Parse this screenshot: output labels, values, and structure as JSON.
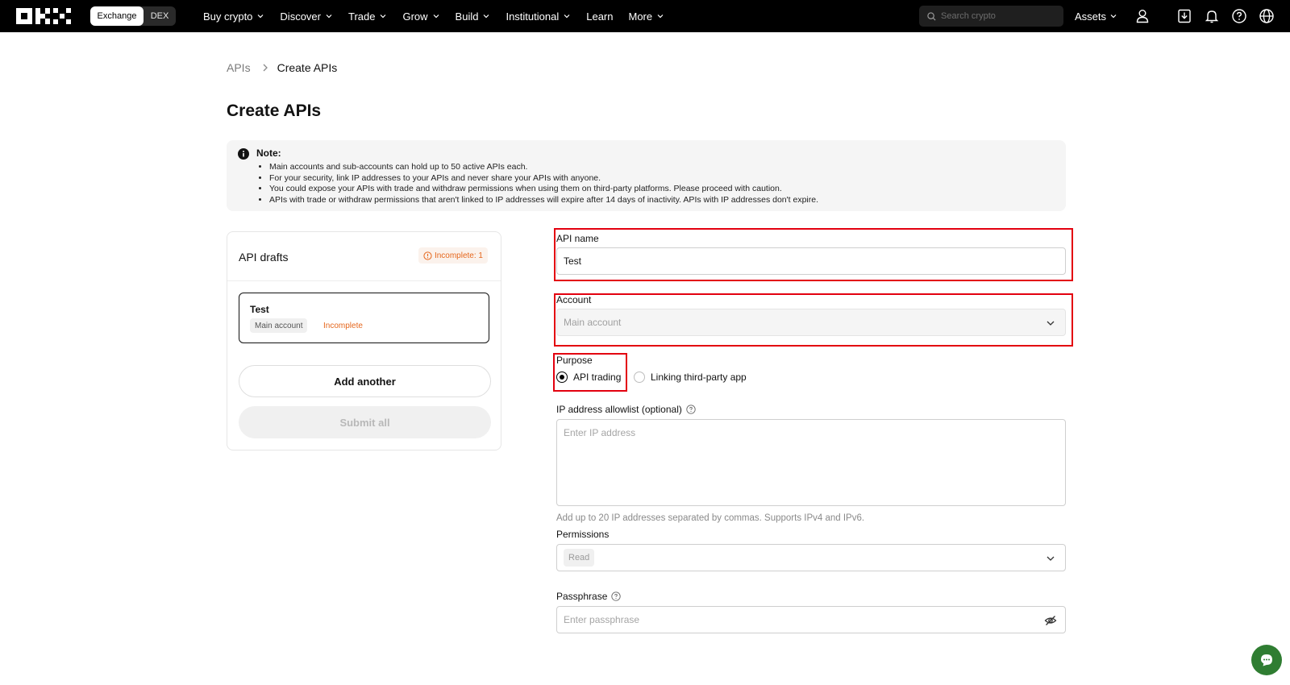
{
  "nav": {
    "toggle": {
      "exchange": "Exchange",
      "dex": "DEX"
    },
    "menu": [
      {
        "label": "Buy crypto",
        "chevron": true
      },
      {
        "label": "Discover",
        "chevron": true
      },
      {
        "label": "Trade",
        "chevron": true
      },
      {
        "label": "Grow",
        "chevron": true
      },
      {
        "label": "Build",
        "chevron": true
      },
      {
        "label": "Institutional",
        "chevron": true
      },
      {
        "label": "Learn",
        "chevron": false
      },
      {
        "label": "More",
        "chevron": true
      }
    ],
    "search_placeholder": "Search crypto",
    "assets_label": "Assets",
    "icons": [
      "user-icon",
      "download-icon",
      "bell-icon",
      "help-icon",
      "globe-icon"
    ]
  },
  "breadcrumb": {
    "parent": "APIs",
    "current": "Create APIs"
  },
  "page_title": "Create APIs",
  "note": {
    "title": "Note:",
    "items": [
      "Main accounts and sub-accounts can hold up to 50 active APIs each.",
      "For your security, link IP addresses to your APIs and never share your APIs with anyone.",
      "You could expose your APIs with trade and withdraw permissions when using them on third-party platforms. Please proceed with caution.",
      "APIs with trade or withdraw permissions that aren't linked to IP addresses will expire after 14 days of inactivity. APIs with IP addresses don't expire."
    ]
  },
  "drafts": {
    "title": "API drafts",
    "incomplete_badge": "Incomplete: 1",
    "items": [
      {
        "name": "Test",
        "account": "Main account",
        "status": "Incomplete"
      }
    ],
    "add_label": "Add another",
    "submit_label": "Submit all"
  },
  "form": {
    "api_name": {
      "label": "API name",
      "value": "Test"
    },
    "account": {
      "label": "Account",
      "value": "Main account"
    },
    "purpose": {
      "label": "Purpose",
      "options": [
        {
          "label": "API trading",
          "checked": true
        },
        {
          "label": "Linking third-party app",
          "checked": false
        }
      ]
    },
    "ip_allowlist": {
      "label": "IP address allowlist (optional)",
      "placeholder": "Enter IP address",
      "hint": "Add up to 20 IP addresses separated by commas. Supports IPv4 and IPv6."
    },
    "permissions": {
      "label": "Permissions",
      "value": "Read"
    },
    "passphrase": {
      "label": "Passphrase",
      "placeholder": "Enter passphrase"
    }
  },
  "colors": {
    "accent_orange": "#e5671d",
    "highlight_red": "#e3000f",
    "chat_green": "#2f7d32"
  }
}
